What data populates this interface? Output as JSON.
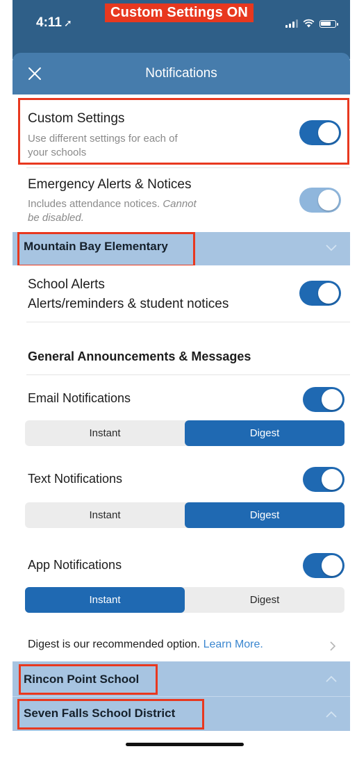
{
  "status_bar": {
    "time": "4:11",
    "location_glyph": "➚"
  },
  "banner": {
    "label": "Custom Settings ON"
  },
  "header": {
    "title": "Notifications",
    "close_icon": "close-icon"
  },
  "custom_settings": {
    "title": "Custom Settings",
    "subtitle_line1": "Use different settings for each of",
    "subtitle_line2": "your schools",
    "enabled": true
  },
  "emergency": {
    "title": "Emergency Alerts & Notices",
    "subtitle_line1": "Includes attendance notices.",
    "subtitle_italic1": "Cannot",
    "subtitle_italic2": "be disabled.",
    "enabled": true
  },
  "schools": [
    {
      "name": "Mountain Bay Elementary",
      "expanded": true
    },
    {
      "name": "Rincon Point School",
      "expanded": false
    },
    {
      "name": "Seven Falls School District",
      "expanded": false
    }
  ],
  "school_alerts": {
    "title": "School Alerts",
    "subtitle": "Alerts/reminders & student notices",
    "enabled": true
  },
  "general_heading": "General Announcements & Messages",
  "email": {
    "title": "Email Notifications",
    "enabled": true,
    "instant": "Instant",
    "digest": "Digest",
    "selected": "Digest"
  },
  "text": {
    "title": "Text Notifications",
    "enabled": true,
    "instant": "Instant",
    "digest": "Digest",
    "selected": "Digest"
  },
  "app": {
    "title": "App Notifications",
    "enabled": true,
    "instant": "Instant",
    "digest": "Digest",
    "selected": "Instant"
  },
  "digest_note": {
    "text": "Digest is our recommended option.",
    "link": "Learn More."
  },
  "colors": {
    "status_bar": "#2f5f88",
    "header": "#467cac",
    "accent": "#1f69b2",
    "school_bar": "#a7c4e1",
    "callout": "#e8381f"
  }
}
